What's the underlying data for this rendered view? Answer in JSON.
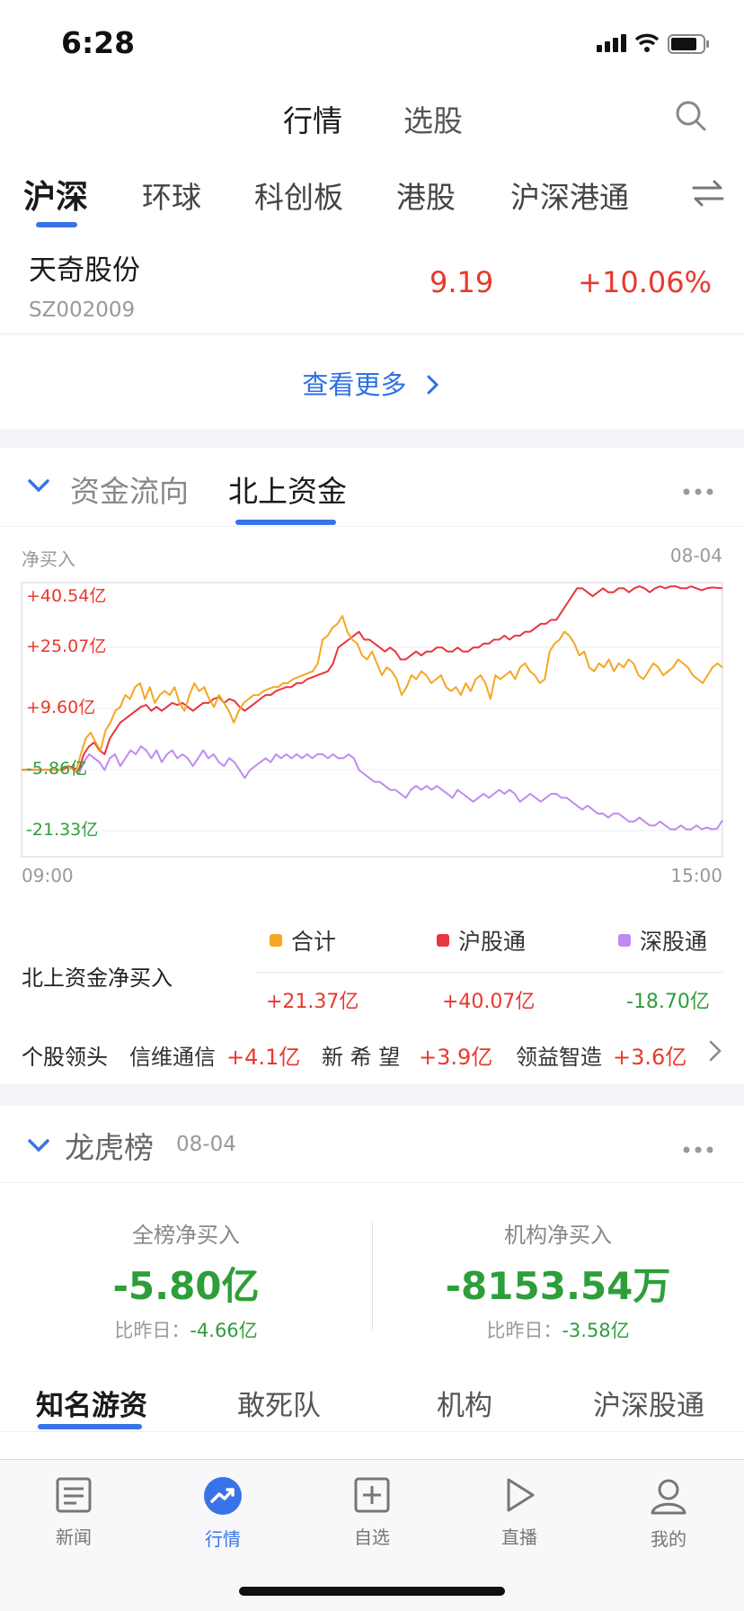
{
  "status_bar": {
    "time": "6:28"
  },
  "top_nav": {
    "tabs": [
      "行情",
      "选股"
    ]
  },
  "market_tabs": [
    "沪深",
    "环球",
    "科创板",
    "港股",
    "沪深港通"
  ],
  "stock": {
    "name": "天奇股份",
    "code": "SZ002009",
    "price": "9.19",
    "change": "+10.06%"
  },
  "see_more": "查看更多",
  "fund_flow": {
    "tabs": [
      "资金流向",
      "北上资金"
    ],
    "y_label": "净买入",
    "date": "08-04",
    "legend": [
      "合计",
      "沪股通",
      "深股通"
    ],
    "row_label": "北上资金净买入",
    "values": [
      "+21.37亿",
      "+40.07亿",
      "-18.70亿"
    ],
    "leaders_label": "个股领头",
    "leaders": [
      {
        "name": "信维通信",
        "value": "+4.1亿"
      },
      {
        "name": "新 希 望",
        "value": "+3.9亿"
      },
      {
        "name": "领益智造",
        "value": "+3.6亿"
      }
    ]
  },
  "chart_data": {
    "type": "line",
    "y_tick_labels": [
      "+40.54亿",
      "+25.07亿",
      "+9.60亿",
      "-5.86亿",
      "-21.33亿"
    ],
    "ylim": [
      -21.33,
      40.54
    ],
    "x_tick_labels": [
      "09:00",
      "15:00"
    ],
    "grid": true,
    "series": [
      {
        "name": "合计",
        "color": "#f5a623",
        "values": [
          -5.9,
          -5.9,
          -5.9,
          -5.9,
          -5.9,
          -5.9,
          -5.9,
          -5.9,
          -5.9,
          -5.0,
          -5.5,
          -6.5,
          -2,
          2,
          3.5,
          1,
          -1,
          4,
          6,
          9,
          10,
          13,
          12,
          15,
          16,
          12,
          15,
          11,
          13,
          14,
          13,
          15,
          11,
          9,
          13,
          16,
          14,
          15,
          12,
          10,
          13,
          11,
          9,
          6,
          9,
          11,
          12,
          13,
          13,
          14,
          14.5,
          15,
          15,
          16,
          16,
          17,
          17.5,
          18,
          18.5,
          19,
          21,
          27,
          28,
          30,
          31,
          33,
          29,
          27,
          26,
          23,
          22,
          24,
          21,
          18,
          20,
          19,
          17,
          13,
          15,
          18,
          17,
          19,
          18,
          16,
          17,
          18,
          15,
          14,
          15,
          13,
          16,
          14,
          17,
          18,
          16,
          12,
          18,
          17,
          18,
          19,
          17,
          20,
          21,
          19,
          18,
          16,
          17,
          24,
          26,
          27,
          29,
          28,
          26,
          23,
          24,
          20,
          19,
          21,
          20,
          22,
          19,
          21,
          20,
          22,
          21,
          18,
          17,
          19,
          21,
          20,
          18,
          19,
          20,
          22,
          21,
          20,
          18,
          17,
          16,
          18,
          20,
          21,
          20
        ]
      },
      {
        "name": "沪股通",
        "color": "#e8353f",
        "values": [
          -5.9,
          -5.9,
          -5.9,
          -5.9,
          -5.9,
          -5.9,
          -5.9,
          -5.9,
          -5.9,
          -5.0,
          -5.5,
          -6.0,
          -2,
          0,
          1,
          -1,
          -2,
          2,
          4,
          6,
          7,
          8,
          9,
          10,
          10.5,
          9,
          10,
          9,
          10,
          11,
          10.5,
          11,
          10,
          9,
          10,
          11,
          11,
          12,
          12.5,
          11,
          12,
          11.5,
          10,
          9,
          10,
          11,
          12,
          13,
          13,
          14,
          14.5,
          15,
          15,
          16,
          16,
          17,
          17.5,
          18,
          18.5,
          19,
          21,
          25,
          26,
          27,
          28,
          29,
          27,
          27,
          26,
          25,
          24,
          25,
          24,
          22,
          22,
          23,
          24,
          23,
          24,
          24,
          25,
          25,
          24,
          24,
          25,
          24,
          24,
          25,
          25,
          26,
          26,
          27,
          27,
          28,
          27,
          28,
          28,
          29,
          29,
          30,
          31,
          31,
          32,
          32,
          34,
          36,
          38,
          40,
          40,
          39,
          38,
          39,
          40,
          39,
          39,
          40,
          40,
          39,
          40,
          40.5,
          40,
          39,
          40,
          40.5,
          40,
          40.5,
          40.5,
          40,
          40,
          40.5,
          40,
          39.5,
          40,
          40.2,
          40.1,
          40
        ]
      },
      {
        "name": "深股通",
        "color": "#c18af0",
        "values": [
          -5.9,
          -5.9,
          -5.9,
          -5.9,
          -5.9,
          -5.9,
          -5.9,
          -5.9,
          -5.9,
          -5.0,
          -6,
          -7,
          -4,
          -2,
          -3,
          -4,
          -6,
          -3,
          -2,
          -5,
          -3,
          -1,
          -2,
          0,
          -1,
          -3,
          -1,
          -4,
          -2,
          -1,
          -3,
          -2,
          -3,
          -5,
          -3,
          -1,
          -3,
          -2,
          -4,
          -5,
          -3,
          -4,
          -6,
          -8,
          -6,
          -5,
          -4,
          -3,
          -4,
          -2,
          -3,
          -2,
          -3,
          -2,
          -3,
          -2,
          -3,
          -2,
          -2,
          -3,
          -2,
          -3,
          -3,
          -2,
          -3,
          -6,
          -7,
          -8,
          -9,
          -9,
          -10,
          -11,
          -11,
          -12,
          -13,
          -11,
          -10,
          -11,
          -10,
          -11,
          -10,
          -11,
          -12,
          -13,
          -11,
          -12,
          -13,
          -14,
          -13,
          -12,
          -13,
          -12,
          -11,
          -12,
          -11,
          -12,
          -14,
          -13,
          -12,
          -13,
          -14,
          -13,
          -12,
          -12,
          -13,
          -13,
          -14,
          -15,
          -16,
          -15,
          -16,
          -17,
          -17,
          -18,
          -17,
          -17,
          -18,
          -19,
          -19,
          -18,
          -19,
          -20,
          -20,
          -19,
          -20,
          -21,
          -21,
          -20,
          -21,
          -21,
          -20,
          -21,
          -20.5,
          -21,
          -20.8,
          -18.7
        ]
      }
    ]
  },
  "lhb": {
    "title": "龙虎榜",
    "date": "08-04",
    "stats": [
      {
        "label": "全榜净买入",
        "value": "-5.80亿",
        "compare_label": "比昨日：",
        "compare_value": "-4.66亿"
      },
      {
        "label": "机构净买入",
        "value": "-8153.54万",
        "compare_label": "比昨日：",
        "compare_value": "-3.58亿"
      }
    ],
    "tabs": [
      "知名游资",
      "敢死队",
      "机构",
      "沪深股通"
    ]
  },
  "tabbar": [
    "新闻",
    "行情",
    "自选",
    "直播",
    "我的"
  ]
}
